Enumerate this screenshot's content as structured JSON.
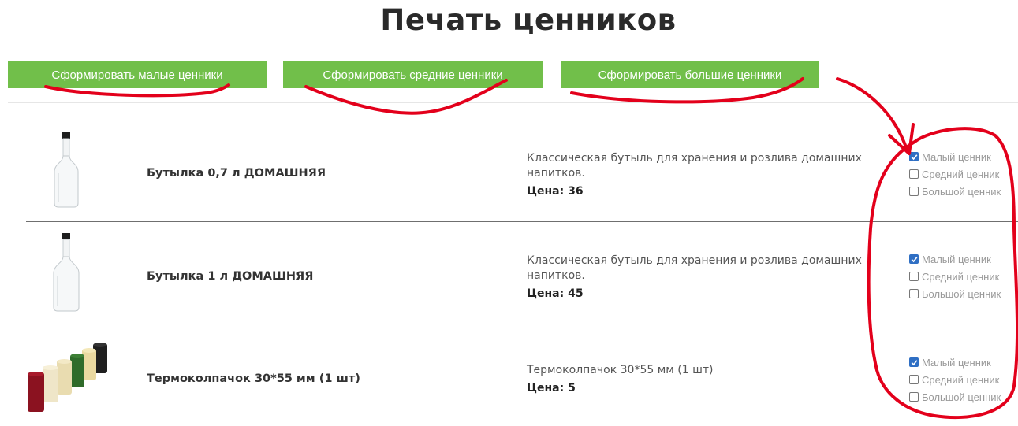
{
  "page": {
    "title": "Печать ценников"
  },
  "buttons": {
    "small": "Сформировать малые ценники",
    "medium": "Сформировать средние ценники",
    "large": "Сформировать большие ценники"
  },
  "products": [
    {
      "name": "Бутылка 0,7 л ДОМАШНЯЯ",
      "description": "Классическая бутыль для хранения и розлива домашних напитков.",
      "price": "Цена: 36",
      "options": [
        {
          "label": "Малый ценник",
          "checked": true
        },
        {
          "label": "Средний ценник",
          "checked": false
        },
        {
          "label": "Большой ценник",
          "checked": false
        }
      ]
    },
    {
      "name": "Бутылка 1 л ДОМАШНЯЯ",
      "description": "Классическая бутыль для хранения и розлива домашних напитков.",
      "price": "Цена: 45",
      "options": [
        {
          "label": "Малый ценник",
          "checked": true
        },
        {
          "label": "Средний ценник",
          "checked": false
        },
        {
          "label": "Большой ценник",
          "checked": false
        }
      ]
    },
    {
      "name": "Термоколпачок 30*55 мм (1 шт)",
      "description": "Термоколпачок 30*55 мм (1 шт)",
      "price": "Цена: 5",
      "options": [
        {
          "label": "Малый ценник",
          "checked": true
        },
        {
          "label": "Средний ценник",
          "checked": false
        },
        {
          "label": "Большой ценник",
          "checked": false
        }
      ]
    }
  ],
  "colors": {
    "button": "#71bf4a",
    "annotation": "#e3001b",
    "checkbox": "#2f6fc4"
  }
}
